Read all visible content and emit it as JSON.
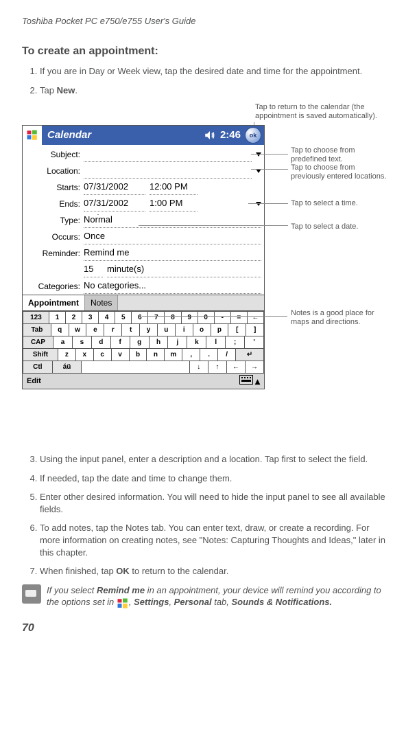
{
  "header": "Toshiba Pocket PC e750/e755  User's Guide",
  "section_title": "To create an appointment:",
  "steps": {
    "s1": "If you are in Day or Week view, tap the desired date and time for the appointment.",
    "s2a": "Tap ",
    "s2b": "New",
    "s2c": ".",
    "s3": "Using the input panel, enter a description and a location. Tap first to select the field.",
    "s4": "If needed, tap the date and time to change them.",
    "s5": "Enter other desired information. You will need to hide the input panel to see all available fields.",
    "s6": "To add notes, tap the  Notes  tab. You can enter text, draw, or create a recording. For more information on creating notes, see \"Notes: Capturing Thoughts and Ideas,\" later in this chapter.",
    "s7a": "When finished, tap  ",
    "s7b": "OK",
    "s7c": "  to return to the calendar."
  },
  "callouts": {
    "return_cal": "Tap to return to the calendar (the appointment is saved automatically).",
    "predef_text": "Tap to choose from predefined text.",
    "prev_loc": "Tap to choose from previously entered locations.",
    "sel_time": "Tap to select a time.",
    "sel_date": "Tap to select a date.",
    "notes_place": "Notes is a good place for maps and directions."
  },
  "device": {
    "app_name": "Calendar",
    "clock": "2:46",
    "ok_label": "ok",
    "titlebar_color": "#3a5fab",
    "fields": {
      "subject_lbl": "Subject:",
      "location_lbl": "Location:",
      "starts_lbl": "Starts:",
      "starts_date": "07/31/2002",
      "starts_time": "12:00 PM",
      "ends_lbl": "Ends:",
      "ends_date": "07/31/2002",
      "ends_time": "1:00 PM",
      "type_lbl": "Type:",
      "type_val": "Normal",
      "occurs_lbl": "Occurs:",
      "occurs_val": "Once",
      "reminder_lbl": "Reminder:",
      "reminder_val": "Remind me",
      "reminder_amt": "15",
      "reminder_unit": "minute(s)",
      "categories_lbl": "Categories:",
      "categories_val": "No categories..."
    },
    "tabs": {
      "appointment": "Appointment",
      "notes": "Notes"
    },
    "sip": {
      "row1": [
        "123",
        "1",
        "2",
        "3",
        "4",
        "5",
        "6",
        "7",
        "8",
        "9",
        "0",
        "-",
        "=",
        "←"
      ],
      "row2": [
        "Tab",
        "q",
        "w",
        "e",
        "r",
        "t",
        "y",
        "u",
        "i",
        "o",
        "p",
        "[",
        "]"
      ],
      "row3": [
        "CAP",
        "a",
        "s",
        "d",
        "f",
        "g",
        "h",
        "j",
        "k",
        "l",
        ";",
        "'"
      ],
      "row4": [
        "Shift",
        "z",
        "x",
        "c",
        "v",
        "b",
        "n",
        "m",
        ",",
        ".",
        "/",
        "↵"
      ],
      "row5": [
        "Ctl",
        "áü",
        " ",
        "↓",
        "↑",
        "←",
        "→"
      ]
    },
    "editbar": "Edit"
  },
  "note": {
    "pre1": " If you select  ",
    "bold1": "Remind me",
    "mid1": " in an appointment, your device will remind you according to the options set in ",
    "mid2": ", ",
    "bold2": "Settings",
    "mid3": ", ",
    "bold3": "Personal",
    "mid4": " tab, ",
    "bold4": "Sounds & Notifications."
  },
  "page_number": "70"
}
